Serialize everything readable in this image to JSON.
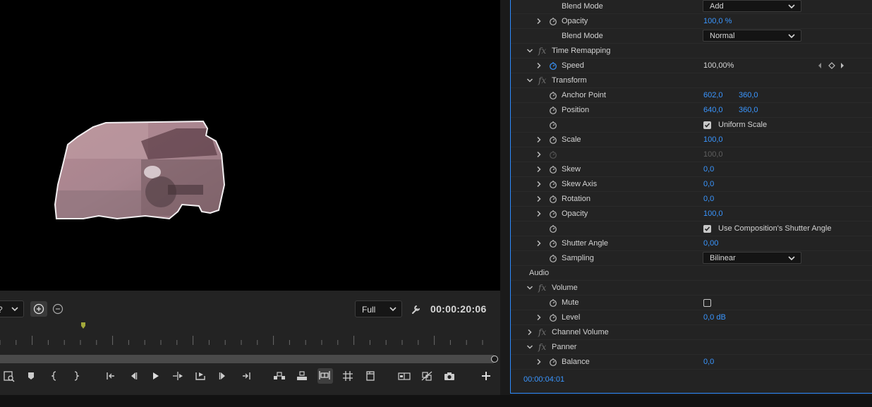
{
  "monitor": {
    "zoom_value": "?",
    "resolution": "Full",
    "timecode": "00:00:20:06"
  },
  "effect_controls": {
    "timecode": "00:00:04:01",
    "rows": [
      {
        "type": "prop",
        "label": "Blend Mode",
        "dropdown": "Add"
      },
      {
        "type": "prop",
        "twirl": true,
        "stopwatch": true,
        "label": "Opacity",
        "value": "100,0 %"
      },
      {
        "type": "prop",
        "label": "Blend Mode",
        "dropdown": "Normal"
      },
      {
        "type": "effect",
        "twirl": "open",
        "fx": true,
        "label": "Time Remapping"
      },
      {
        "type": "prop",
        "twirl": true,
        "stopwatch": "active",
        "label": "Speed",
        "value_white": "100,00%",
        "keyframes": true
      },
      {
        "type": "effect",
        "twirl": "open",
        "fx": true,
        "label": "Transform"
      },
      {
        "type": "prop",
        "stopwatch": true,
        "label": "Anchor Point",
        "value": "602,0",
        "value2": "360,0"
      },
      {
        "type": "prop",
        "stopwatch": true,
        "label": "Position",
        "value": "640,0",
        "value2": "360,0"
      },
      {
        "type": "prop",
        "stopwatch": true,
        "label": "",
        "checkbox": "Uniform Scale"
      },
      {
        "type": "prop",
        "twirl": true,
        "stopwatch": true,
        "label": "Scale",
        "value": "100,0"
      },
      {
        "type": "prop",
        "twirl": true,
        "stopwatch": "dim",
        "label": "",
        "value_dim": "100,0"
      },
      {
        "type": "prop",
        "twirl": true,
        "stopwatch": true,
        "label": "Skew",
        "value": "0,0"
      },
      {
        "type": "prop",
        "twirl": true,
        "stopwatch": true,
        "label": "Skew Axis",
        "value": "0,0"
      },
      {
        "type": "prop",
        "twirl": true,
        "stopwatch": true,
        "label": "Rotation",
        "value": "0,0"
      },
      {
        "type": "prop",
        "twirl": true,
        "stopwatch": true,
        "label": "Opacity",
        "value": "100,0"
      },
      {
        "type": "prop",
        "stopwatch": true,
        "label": "",
        "checkbox": "Use Composition's Shutter Angle"
      },
      {
        "type": "prop",
        "twirl": true,
        "stopwatch": true,
        "label": "Shutter Angle",
        "value": "0,00"
      },
      {
        "type": "prop",
        "stopwatch": true,
        "label": "Sampling",
        "dropdown": "Bilinear"
      },
      {
        "type": "section",
        "label": "Audio"
      },
      {
        "type": "effect",
        "twirl": "open",
        "fx": true,
        "label": "Volume"
      },
      {
        "type": "prop",
        "stopwatch": true,
        "label": "Mute",
        "checkbox_empty": true
      },
      {
        "type": "prop",
        "twirl": true,
        "stopwatch": true,
        "label": "Level",
        "value": "0,0 dB"
      },
      {
        "type": "effect",
        "twirl": "closed",
        "fx": true,
        "label": "Channel Volume"
      },
      {
        "type": "effect",
        "twirl": "open",
        "fx": true,
        "label": "Panner"
      },
      {
        "type": "prop",
        "twirl": true,
        "stopwatch": true,
        "label": "Balance",
        "value": "0,0"
      }
    ]
  }
}
